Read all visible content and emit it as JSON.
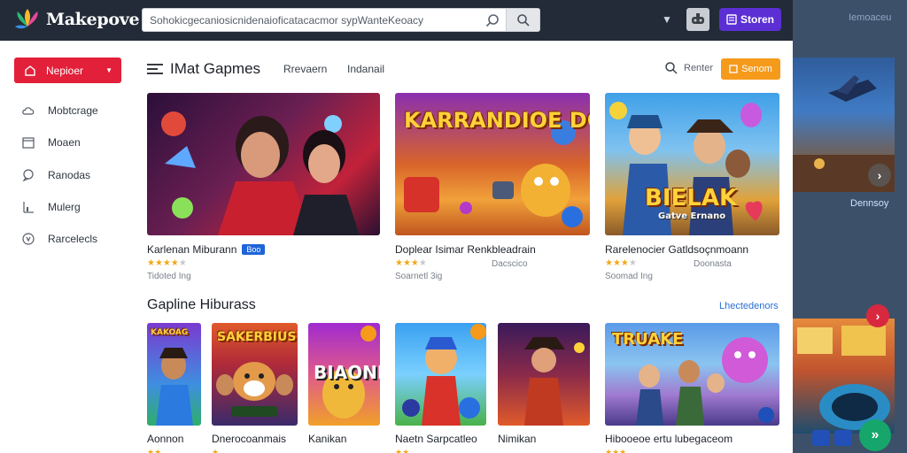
{
  "app": {
    "name": "Makepove",
    "search_placeholder": "Sohokicgecaniosicnidenaioficatacacmor sypWanteKeoacy",
    "store_label": "Storen"
  },
  "right_panel": {
    "top_label": "Iemoaceu",
    "card_label": "Dennsoy"
  },
  "sidebar": {
    "active": "Nepioer",
    "items": [
      "Mobtcrage",
      "Moaen",
      "Ranodas",
      "Mulerg",
      "Rarcelecls"
    ]
  },
  "content": {
    "title": "IMat Gapmes",
    "tabs": [
      "Rrevaern",
      "Indanail"
    ],
    "filter_label": "Renter",
    "orange_button": "Senom"
  },
  "featured": [
    {
      "title": "Karlenan Miburann",
      "badge": "Boo",
      "rating": 4,
      "subtitle": "",
      "meta": "Tidoted Ing",
      "art_text": ""
    },
    {
      "title": "Doplear Isimar Renkbleadrain",
      "badge": "",
      "rating": 3,
      "subtitle": "Dacscico",
      "meta": "Soarnetl 3ig",
      "art_text": "KARRANDIOE DOUHRIONE"
    },
    {
      "title": "Rarelenocier Gatldsoçnmoann",
      "badge": "",
      "rating": 3,
      "subtitle": "Doonasta",
      "meta": "Soomad Ing",
      "art_text": "BIELAK",
      "art_sub": "Gatve Ernano"
    }
  ],
  "section2": {
    "title": "Gapline Hiburass",
    "link": "Lhectedenors",
    "games": [
      {
        "title": "Aonnon",
        "art_text": "KAKOAG"
      },
      {
        "title": "Dnerocoanmais",
        "art_text": "SAKERBIUS"
      },
      {
        "title": "Kanikan",
        "art_text": "BIAONE"
      },
      {
        "title": "Naetn Sarpcatleo",
        "art_text": ""
      },
      {
        "title": "Nimikan",
        "art_text": ""
      },
      {
        "title": "Hibooeoe ertu lubegaceom",
        "art_text": "TRUAKE"
      }
    ]
  },
  "colors": {
    "topbar": "#232b38",
    "accent_red": "#e2203a",
    "accent_purple": "#5b2fd3",
    "accent_orange": "#f59a1b",
    "link_blue": "#2a6fd6",
    "star": "#f2a916"
  }
}
